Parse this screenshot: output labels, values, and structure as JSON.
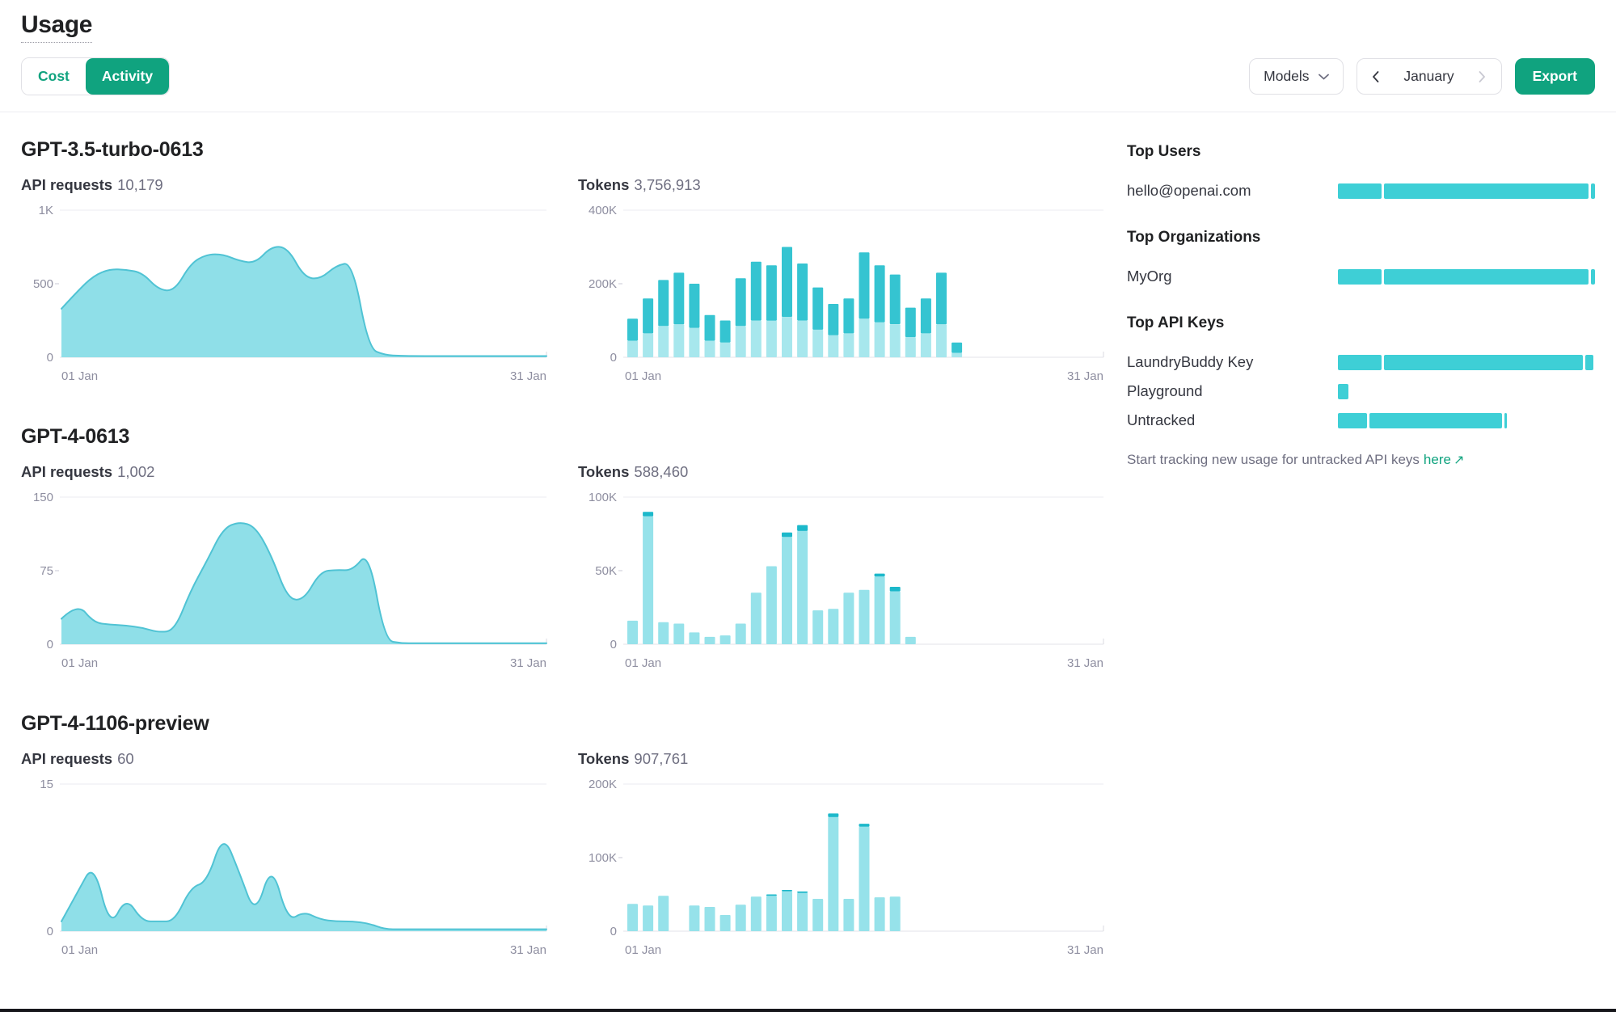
{
  "page": {
    "title": "Usage"
  },
  "toolbar": {
    "cost": "Cost",
    "activity": "Activity",
    "models": "Models",
    "month": "January",
    "export": "Export"
  },
  "colors": {
    "accent_green": "#10a37f",
    "teal": "#35c4d1",
    "teal_light": "#a7e7ed",
    "area_fill": "#8fdfe8",
    "area_stroke": "#50c3d4",
    "bar_cap": "#1cb8ca",
    "sidebar_bar": "#3ecfd6",
    "axis_text": "#8e8ea0",
    "gridline": "#ebebf0"
  },
  "sections": [
    {
      "model": "GPT-3.5-turbo-0613",
      "requests_label": "API requests",
      "requests_value": "10,179",
      "tokens_label": "Tokens",
      "tokens_value": "3,756,913",
      "requests_chart": 0,
      "tokens_chart": 1
    },
    {
      "model": "GPT-4-0613",
      "requests_label": "API requests",
      "requests_value": "1,002",
      "tokens_label": "Tokens",
      "tokens_value": "588,460",
      "requests_chart": 2,
      "tokens_chart": 3
    },
    {
      "model": "GPT-4-1106-preview",
      "requests_label": "API requests",
      "requests_value": "60",
      "tokens_label": "Tokens",
      "tokens_value": "907,761",
      "requests_chart": 4,
      "tokens_chart": 5
    }
  ],
  "sidebar": {
    "groups": [
      {
        "title": "Top Users",
        "rows": [
          {
            "label": "hello@openai.com",
            "segments": [
              17,
              80.5,
              1.5
            ]
          }
        ]
      },
      {
        "title": "Top Organizations",
        "rows": [
          {
            "label": "MyOrg",
            "segments": [
              17,
              80.5,
              1.5
            ]
          }
        ]
      },
      {
        "title": "Top API Keys",
        "rows": [
          {
            "label": "LaundryBuddy Key",
            "segments": [
              17,
              77.5,
              3
            ]
          },
          {
            "label": "Playground",
            "segments": [
              4.2
            ]
          },
          {
            "label": "Untracked",
            "segments": [
              11.3,
              51.5,
              0.9
            ]
          }
        ]
      }
    ],
    "footer_text": "Start tracking new usage for untracked API keys",
    "footer_link": "here",
    "footer_arrow": "↗"
  },
  "chart_data": [
    {
      "type": "area",
      "name": "gpt-3.5-turbo-0613-api-requests-by-day",
      "x": [
        "01 Jan",
        "31 Jan"
      ],
      "ylim": [
        0,
        1000
      ],
      "yticks": [
        "1K",
        "500",
        "0"
      ],
      "fill": "#8fdfe8",
      "stroke": "#50c3d4",
      "values": [
        330,
        450,
        555,
        600,
        595,
        575,
        460,
        450,
        640,
        700,
        700,
        655,
        640,
        755,
        745,
        545,
        530,
        625,
        645,
        60,
        15,
        10,
        8,
        8,
        8,
        8,
        8,
        8,
        8,
        8,
        8
      ]
    },
    {
      "type": "stacked-bar",
      "name": "gpt-3.5-turbo-0613-tokens-by-day",
      "x": [
        "01 Jan",
        "31 Jan"
      ],
      "ylim": [
        0,
        400000
      ],
      "yticks": [
        "400K",
        "200K",
        "0"
      ],
      "series": [
        {
          "name": "base",
          "color": "#a7e7ed",
          "values": [
            45000,
            65000,
            85000,
            90000,
            80000,
            45000,
            40000,
            85000,
            100000,
            100000,
            110000,
            100000,
            75000,
            60000,
            65000,
            105000,
            95000,
            90000,
            55000,
            65000,
            90000,
            12000,
            0,
            0,
            0,
            0,
            0,
            0,
            0,
            0,
            0
          ]
        },
        {
          "name": "top",
          "color": "#35c4d1",
          "values": [
            60000,
            95000,
            125000,
            140000,
            120000,
            70000,
            60000,
            130000,
            160000,
            150000,
            190000,
            155000,
            115000,
            85000,
            95000,
            180000,
            155000,
            135000,
            80000,
            95000,
            140000,
            28000,
            0,
            0,
            0,
            0,
            0,
            0,
            0,
            0,
            0
          ]
        }
      ]
    },
    {
      "type": "area",
      "name": "gpt-4-0613-api-requests-by-day",
      "x": [
        "01 Jan",
        "31 Jan"
      ],
      "ylim": [
        0,
        150
      ],
      "yticks": [
        "150",
        "75",
        "0"
      ],
      "fill": "#8fdfe8",
      "stroke": "#50c3d4",
      "values": [
        26,
        42,
        22,
        20,
        19,
        17,
        12,
        14,
        55,
        85,
        118,
        125,
        120,
        90,
        46,
        45,
        74,
        76,
        75,
        95,
        4,
        1,
        1,
        1,
        1,
        1,
        1,
        1,
        1,
        1,
        1
      ]
    },
    {
      "type": "stacked-bar",
      "name": "gpt-4-0613-tokens-by-day",
      "x": [
        "01 Jan",
        "31 Jan"
      ],
      "ylim": [
        0,
        100000
      ],
      "yticks": [
        "100K",
        "50K",
        "0"
      ],
      "series": [
        {
          "name": "base",
          "color": "#96e2ea",
          "values": [
            16000,
            87000,
            15000,
            14000,
            8000,
            5000,
            6000,
            14000,
            35000,
            53000,
            73000,
            77000,
            23000,
            24000,
            35000,
            37000,
            46000,
            36000,
            5000,
            0,
            0,
            0,
            0,
            0,
            0,
            0,
            0,
            0,
            0,
            0,
            0
          ]
        },
        {
          "name": "top",
          "color": "#1cb8ca",
          "values": [
            0,
            3000,
            0,
            0,
            0,
            0,
            0,
            0,
            0,
            0,
            3000,
            4000,
            0,
            0,
            0,
            0,
            2000,
            3000,
            0,
            0,
            0,
            0,
            0,
            0,
            0,
            0,
            0,
            0,
            0,
            0,
            0
          ]
        }
      ]
    },
    {
      "type": "area",
      "name": "gpt-4-1106-preview-api-requests-by-day",
      "x": [
        "01 Jan",
        "31 Jan"
      ],
      "ylim": [
        0,
        15
      ],
      "yticks": [
        "15",
        "0"
      ],
      "fill": "#8fdfe8",
      "stroke": "#50c3d4",
      "values": [
        1,
        4,
        7,
        0.3,
        3.5,
        1,
        1,
        1,
        4.5,
        5,
        10,
        6,
        1.5,
        7,
        1,
        2,
        1.2,
        1,
        1,
        0.8,
        0.2,
        0.2,
        0.2,
        0.2,
        0.2,
        0.2,
        0.2,
        0.2,
        0.2,
        0.2,
        0.2
      ]
    },
    {
      "type": "stacked-bar",
      "name": "gpt-4-1106-preview-tokens-by-day",
      "x": [
        "01 Jan",
        "31 Jan"
      ],
      "ylim": [
        0,
        200000
      ],
      "yticks": [
        "200K",
        "100K",
        "0"
      ],
      "series": [
        {
          "name": "base",
          "color": "#96e2ea",
          "values": [
            37000,
            35000,
            48000,
            0,
            35000,
            33000,
            22000,
            36000,
            47000,
            48000,
            54000,
            52000,
            44000,
            155000,
            44000,
            142000,
            46000,
            47000,
            0,
            0,
            0,
            0,
            0,
            0,
            0,
            0,
            0,
            0,
            0,
            0,
            0
          ]
        },
        {
          "name": "top",
          "color": "#1cb8ca",
          "values": [
            0,
            0,
            0,
            0,
            0,
            0,
            0,
            0,
            0,
            2000,
            2000,
            2000,
            0,
            5000,
            0,
            4000,
            0,
            0,
            0,
            0,
            0,
            0,
            0,
            0,
            0,
            0,
            0,
            0,
            0,
            0,
            0
          ]
        }
      ]
    }
  ]
}
